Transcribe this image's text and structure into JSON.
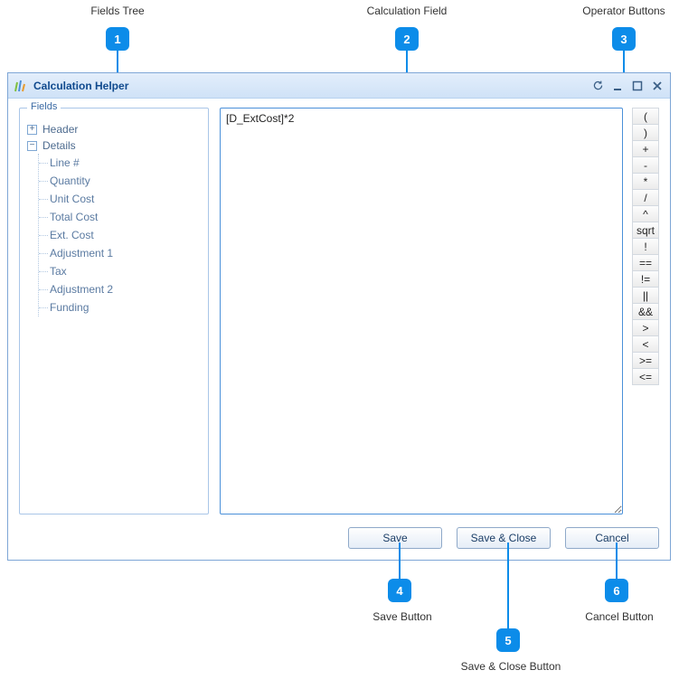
{
  "annotations": {
    "a1": {
      "label": "Fields Tree",
      "num": "1"
    },
    "a2": {
      "label": "Calculation Field",
      "num": "2"
    },
    "a3": {
      "label": "Operator Buttons",
      "num": "3"
    },
    "a4": {
      "label": "Save Button",
      "num": "4"
    },
    "a5": {
      "label": "Save & Close Button",
      "num": "5"
    },
    "a6": {
      "label": "Cancel Button",
      "num": "6"
    }
  },
  "window": {
    "title": "Calculation Helper"
  },
  "fields": {
    "legend": "Fields",
    "header_label": "Header",
    "details_label": "Details",
    "details_children": {
      "c0": "Line #",
      "c1": "Quantity",
      "c2": "Unit Cost",
      "c3": "Total Cost",
      "c4": "Ext. Cost",
      "c5": "Adjustment 1",
      "c6": "Tax",
      "c7": "Adjustment 2",
      "c8": "Funding"
    }
  },
  "calc": {
    "value": "[D_ExtCost]*2"
  },
  "operators": {
    "o0": "(",
    "o1": ")",
    "o2": "+",
    "o3": "-",
    "o4": "*",
    "o5": "/",
    "o6": "^",
    "o7": "sqrt",
    "o8": "!",
    "o9": "==",
    "o10": "!=",
    "o11": "||",
    "o12": "&&",
    "o13": ">",
    "o14": "<",
    "o15": ">=",
    "o16": "<="
  },
  "buttons": {
    "save": "Save",
    "save_close": "Save & Close",
    "cancel": "Cancel"
  }
}
